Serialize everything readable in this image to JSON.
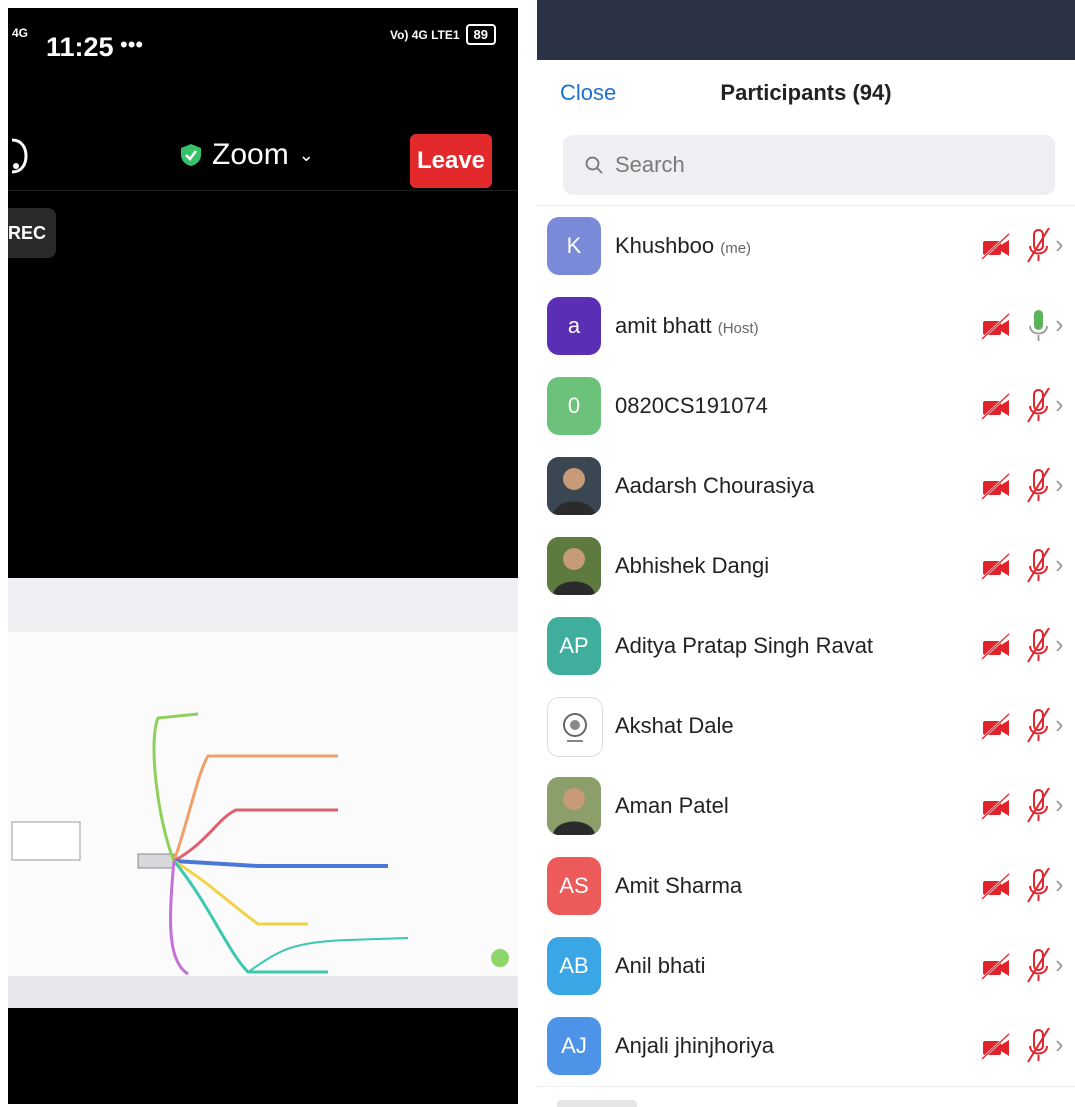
{
  "left_phone": {
    "status": {
      "signal": "4G",
      "time": "11:25",
      "dots": "•••",
      "network": "Vo) 4G LTE1",
      "battery": "89"
    },
    "meeting_title": "Zoom",
    "leave_label": "Leave",
    "rec_label": "REC"
  },
  "right_phone": {
    "close_label": "Close",
    "title": "Participants (94)",
    "search_placeholder": "Search",
    "participants": [
      {
        "name": "Khushboo",
        "role": "(me)",
        "initials": "K",
        "color": "#7b8ad8",
        "mic_on": false
      },
      {
        "name": "amit bhatt",
        "role": "(Host)",
        "initials": "a",
        "color": "#5b2fb5",
        "mic_on": true
      },
      {
        "name": "0820CS191074",
        "role": "",
        "initials": "0",
        "color": "#6cc27a",
        "mic_on": false
      },
      {
        "name": "Aadarsh Chourasiya",
        "role": "",
        "initials": "",
        "color": "#3a4652",
        "mic_on": false
      },
      {
        "name": "Abhishek Dangi",
        "role": "",
        "initials": "",
        "color": "#5d7a3f",
        "mic_on": false
      },
      {
        "name": "Aditya Pratap Singh Ravat",
        "role": "",
        "initials": "AP",
        "color": "#3fae9d",
        "mic_on": false
      },
      {
        "name": "Akshat Dale",
        "role": "",
        "initials": "",
        "color": "#ffffff",
        "mic_on": false
      },
      {
        "name": "Aman Patel",
        "role": "",
        "initials": "",
        "color": "#8c9e6a",
        "mic_on": false
      },
      {
        "name": "Amit Sharma",
        "role": "",
        "initials": "AS",
        "color": "#ec5a5a",
        "mic_on": false
      },
      {
        "name": "Anil bhati",
        "role": "",
        "initials": "AB",
        "color": "#3aa6e6",
        "mic_on": false
      },
      {
        "name": "Anjali jhinjhoriya",
        "role": "",
        "initials": "AJ",
        "color": "#4d93e8",
        "mic_on": false
      }
    ]
  },
  "colors": {
    "leave_red": "#e3292c",
    "close_blue": "#1f6fd1",
    "muted_red": "#e0242c",
    "mic_green": "#5bb25b"
  }
}
